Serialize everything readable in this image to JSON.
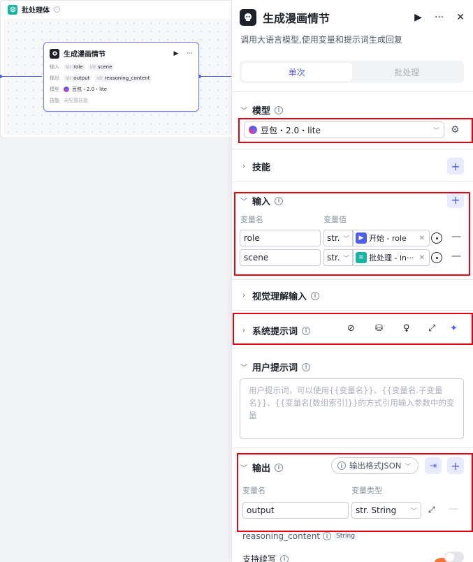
{
  "canvas": {
    "batch_title": "批处理体",
    "node": {
      "title": "生成漫画情节",
      "run_icon": "▶",
      "more_icon": "···",
      "input_label": "输入",
      "inputs": [
        {
          "type": "str",
          "name": "role"
        },
        {
          "type": "str",
          "name": "scene"
        }
      ],
      "output_label": "输出",
      "outputs": [
        {
          "type": "str",
          "name": "output"
        },
        {
          "type": "str",
          "name": "reasoning_content"
        }
      ],
      "model_label": "模型",
      "model_value": "豆包・2.0・lite",
      "skill_label": "技能",
      "skill_value": "未配置技能"
    }
  },
  "panel": {
    "title": "生成漫画情节",
    "description": "调用大语言模型,使用变量和提示词生成回复",
    "run_icon": "▶",
    "more_icon": "···",
    "close_icon": "✕",
    "tabs": [
      {
        "label": "单次",
        "active": true
      },
      {
        "label": "批处理",
        "active": false
      }
    ],
    "model_section": {
      "title": "模型",
      "selected_model": "豆包・2.0・lite"
    },
    "skills_section": {
      "title": "技能"
    },
    "input_section": {
      "title": "输入",
      "col_name": "变量名",
      "col_value": "变量值",
      "rows": [
        {
          "name": "role",
          "type": "str.",
          "ref_text": "开始 - role",
          "ref_kind": "start"
        },
        {
          "name": "scene",
          "type": "str.",
          "ref_text": "批处理 - in···",
          "ref_kind": "batch"
        }
      ]
    },
    "visual_section": {
      "title": "视觉理解输入"
    },
    "system_prompt_section": {
      "title": "系统提示词"
    },
    "user_prompt_section": {
      "title": "用户提示词",
      "placeholder": "用户提示词，可以使用{{变量名}}、{{变量名.子变量名}}、{{变量名[数组索引]}}的方式引用输入参数中的变量"
    },
    "output_section": {
      "title": "输出",
      "format_label": "输出格式JSON",
      "col_name": "变量名",
      "col_type": "变量类型",
      "row": {
        "name": "output",
        "type": "str. String"
      },
      "reasoning_name": "reasoning_content",
      "reasoning_badge": "String"
    },
    "streaming": {
      "label": "支持续写"
    }
  },
  "colors": {
    "accent": "#4e5ff2",
    "highlight": "#e60012",
    "teal": "#15b4a4"
  }
}
